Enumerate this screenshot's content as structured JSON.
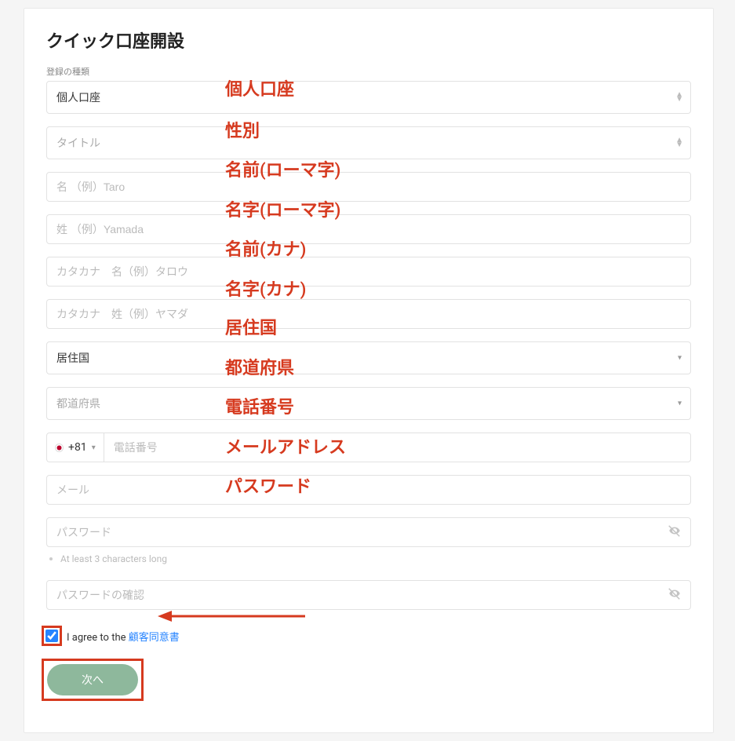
{
  "title": "クイック口座開設",
  "accountType": {
    "label": "登録の種類",
    "value": "個人口座"
  },
  "titleField": {
    "placeholder": "タイトル"
  },
  "firstName": {
    "placeholder": "名 （例）Taro"
  },
  "lastName": {
    "placeholder": "姓 （例）Yamada"
  },
  "firstNameKana": {
    "placeholder": "カタカナ　名（例）タロウ"
  },
  "lastNameKana": {
    "placeholder": "カタカナ　姓（例）ヤマダ"
  },
  "country": {
    "value": "居住国"
  },
  "prefecture": {
    "placeholder": "都道府県"
  },
  "phone": {
    "dialCode": "+81",
    "placeholder": "電話番号"
  },
  "email": {
    "placeholder": "メール"
  },
  "password": {
    "placeholder": "パスワード",
    "hint": "At least 3 characters long"
  },
  "passwordConfirm": {
    "placeholder": "パスワードの確認"
  },
  "agree": {
    "prefix": "I agree to the ",
    "linkText": "顧客同意書",
    "checked": true
  },
  "nextButton": "次へ",
  "annotations": {
    "accountType": "個人口座",
    "title": "性別",
    "firstName": "名前(ローマ字)",
    "lastName": "名字(ローマ字)",
    "firstNameKana": "名前(カナ)",
    "lastNameKana": "名字(カナ)",
    "country": "居住国",
    "prefecture": "都道府県",
    "phone": "電話番号",
    "email": "メールアドレス",
    "password": "パスワード"
  }
}
